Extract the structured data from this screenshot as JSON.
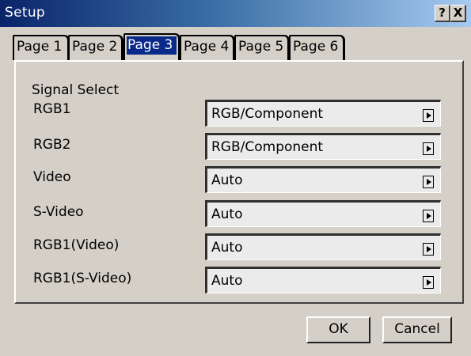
{
  "window": {
    "title": "Setup",
    "help_label": "?",
    "close_label": "X"
  },
  "tabs": [
    {
      "label": "Page 1",
      "active": false
    },
    {
      "label": "Page 2",
      "active": false
    },
    {
      "label": "Page 3",
      "active": true
    },
    {
      "label": "Page 4",
      "active": false
    },
    {
      "label": "Page 5",
      "active": false
    },
    {
      "label": "Page 6",
      "active": false
    }
  ],
  "section": {
    "title": "Signal Select"
  },
  "rows": [
    {
      "label": "RGB1",
      "value": "RGB/Component"
    },
    {
      "label": "RGB2",
      "value": "RGB/Component"
    },
    {
      "label": "Video",
      "value": "Auto"
    },
    {
      "label": "S-Video",
      "value": "Auto"
    },
    {
      "label": "RGB1(Video)",
      "value": "Auto"
    },
    {
      "label": "RGB1(S-Video)",
      "value": "Auto"
    }
  ],
  "buttons": {
    "ok": "OK",
    "cancel": "Cancel"
  }
}
